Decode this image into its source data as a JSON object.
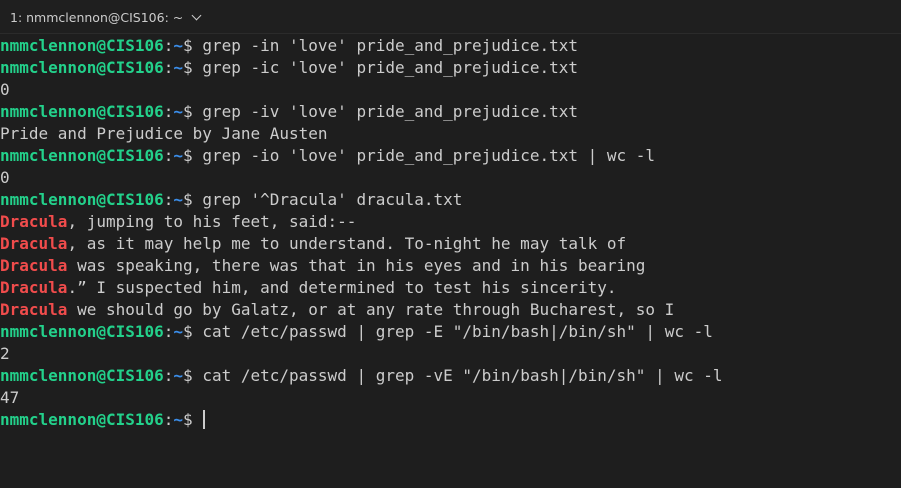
{
  "tab": {
    "title": "1: nmmclennon@CIS106: ~",
    "menu_icon": "chevron-down-icon"
  },
  "prompt": {
    "user_host": "nmmclennon@CIS106",
    "colon": ":",
    "path": "~",
    "symbol": "$ "
  },
  "lines": [
    {
      "type": "prompt",
      "cmd": "grep -in 'love' pride_and_prejudice.txt"
    },
    {
      "type": "prompt",
      "cmd": "grep -ic 'love' pride_and_prejudice.txt"
    },
    {
      "type": "out",
      "text": "0"
    },
    {
      "type": "prompt",
      "cmd": "grep -iv 'love' pride_and_prejudice.txt"
    },
    {
      "type": "out",
      "text": "Pride and Prejudice by Jane Austen"
    },
    {
      "type": "prompt",
      "cmd": "grep -io 'love' pride_and_prejudice.txt | wc -l"
    },
    {
      "type": "out",
      "text": "0"
    },
    {
      "type": "prompt",
      "cmd": "grep '^Dracula' dracula.txt"
    },
    {
      "type": "match",
      "match": "Dracula",
      "rest": ", jumping to his feet, said:--"
    },
    {
      "type": "match",
      "match": "Dracula",
      "rest": ", as it may help me to understand. To-night he may talk of"
    },
    {
      "type": "match",
      "match": "Dracula",
      "rest": " was speaking, there was that in his eyes and in his bearing"
    },
    {
      "type": "match",
      "match": "Dracula",
      "rest": ".” I suspected him, and determined to test his sincerity."
    },
    {
      "type": "match",
      "match": "Dracula",
      "rest": " we should go by Galatz, or at any rate through Bucharest, so I"
    },
    {
      "type": "prompt",
      "cmd": "cat /etc/passwd | grep -E \"/bin/bash|/bin/sh\" | wc -l"
    },
    {
      "type": "out",
      "text": "2"
    },
    {
      "type": "prompt",
      "cmd": "cat /etc/passwd | grep -vE \"/bin/bash|/bin/sh\" | wc -l"
    },
    {
      "type": "out",
      "text": "47"
    },
    {
      "type": "current",
      "cmd": ""
    }
  ],
  "colors": {
    "background": "#1e1e1e",
    "prompt_user": "#23d18b",
    "prompt_path": "#3b8eea",
    "match": "#f14c4c",
    "text": "#cccccc"
  }
}
